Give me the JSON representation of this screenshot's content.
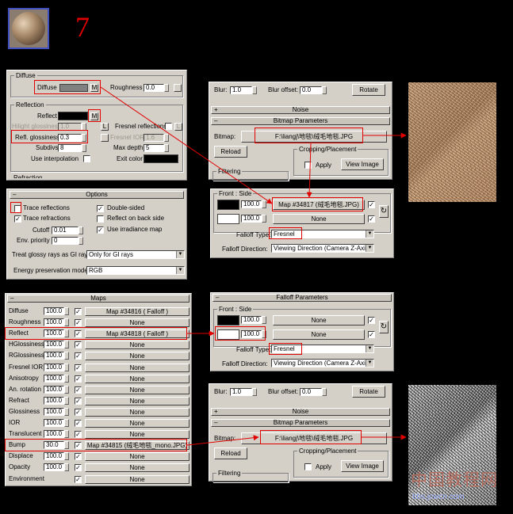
{
  "step_number": "7",
  "watermark": {
    "line1": "中国教程网",
    "line2": "bbs.jcwcn.com"
  },
  "vray_mtl": {
    "diffuse_group": "Diffuse",
    "diffuse_label": "Diffuse",
    "map_btn": "M",
    "roughness_label": "Roughness",
    "roughness_value": "0.0",
    "reflection_group": "Reflection",
    "reflect_label": "Reflect",
    "hilight_label": "Hilight glossiness",
    "hilight_value": "1.0",
    "lock_btn": "L",
    "fresnel_label": "Fresnel reflections",
    "refl_gloss_label": "Refl. glossiness",
    "refl_gloss_value": "0.3",
    "fresnel_ior_label": "Fresnel IOR",
    "fresnel_ior_value": "1.6",
    "subdivs_label": "Subdivs",
    "subdivs_value": "8",
    "max_depth_label": "Max depth",
    "max_depth_value": "5",
    "use_interp_label": "Use interpolation",
    "exit_color_label": "Exit color",
    "partial_label": "Refraction"
  },
  "options": {
    "title": "Options",
    "trace_reflections": "Trace reflections",
    "trace_refractions": "Trace refractions",
    "double_sided": "Double-sided",
    "reflect_back": "Reflect on back side",
    "use_irradiance": "Use irradiance map",
    "cutoff_label": "Cutoff",
    "cutoff_value": "0.01",
    "env_priority_label": "Env. priority",
    "env_priority_value": "0",
    "glossy_gi_label": "Treat glossy rays as GI rays:",
    "glossy_gi_value": "Only for GI rays",
    "energy_label": "Energy preservation mode:",
    "energy_value": "RGB"
  },
  "maps": {
    "title": "Maps",
    "rows": [
      {
        "name": "Diffuse",
        "amount": "100.0",
        "map": "Map #34816  ( Falloff )"
      },
      {
        "name": "Roughness",
        "amount": "100.0",
        "map": "None"
      },
      {
        "name": "Reflect",
        "amount": "100.0",
        "map": "Map #34818  ( Falloff )"
      },
      {
        "name": "HGlossiness",
        "amount": "100.0",
        "map": "None"
      },
      {
        "name": "RGlossiness",
        "amount": "100.0",
        "map": "None"
      },
      {
        "name": "Fresnel IOR",
        "amount": "100.0",
        "map": "None"
      },
      {
        "name": "Anisotropy",
        "amount": "100.0",
        "map": "None"
      },
      {
        "name": "An. rotation",
        "amount": "100.0",
        "map": "None"
      },
      {
        "name": "Refract",
        "amount": "100.0",
        "map": "None"
      },
      {
        "name": "Glossiness",
        "amount": "100.0",
        "map": "None"
      },
      {
        "name": "IOR",
        "amount": "100.0",
        "map": "None"
      },
      {
        "name": "Translucent",
        "amount": "100.0",
        "map": "None"
      },
      {
        "name": "Bump",
        "amount": "30.0",
        "map": "Map #34815 (绒毛地毯_mono.JPG)"
      },
      {
        "name": "Displace",
        "amount": "100.0",
        "map": "None"
      },
      {
        "name": "Opacity",
        "amount": "100.0",
        "map": "None"
      },
      {
        "name": "Environment",
        "amount": "",
        "map": "None"
      }
    ]
  },
  "bitmap1": {
    "blur_label": "Blur:",
    "blur_value": "1.0",
    "blur_offset_label": "Blur offset:",
    "blur_offset_value": "0.0",
    "rotate_btn": "Rotate",
    "noise_title": "Noise",
    "bitmap_params_title": "Bitmap Parameters",
    "bitmap_label": "Bitmap:",
    "bitmap_path": "F:\\liangj\\地毯\\绒毛地毯.JPG",
    "reload_btn": "Reload",
    "cropping_label": "Cropping/Placement",
    "apply_label": "Apply",
    "view_image_btn": "View Image",
    "filtering_label": "Filtering"
  },
  "falloff1": {
    "group_label": "Front : Side",
    "amount1": "100.0",
    "map1": "Map #34817 (绒毛地毯.JPG)",
    "amount2": "100.0",
    "map2": "None",
    "falloff_type_label": "Falloff Type:",
    "falloff_type_value": "Fresnel",
    "falloff_dir_label": "Falloff Direction:",
    "falloff_dir_value": "Viewing Direction (Camera Z-Axis)"
  },
  "falloff2": {
    "title": "Falloff Parameters",
    "group_label": "Front : Side",
    "amount1": "100.0",
    "map1": "None",
    "amount2": "100.0",
    "map2": "None",
    "falloff_type_label": "Falloff Type:",
    "falloff_type_value": "Fresnel",
    "falloff_dir_label": "Falloff Direction:",
    "falloff_dir_value": "Viewing Direction (Camera Z-Axis)"
  },
  "bitmap2": {
    "blur_label": "Blur:",
    "blur_value": "1.0",
    "blur_offset_label": "Blur offset:",
    "blur_offset_value": "0.0",
    "rotate_btn": "Rotate",
    "noise_title": "Noise",
    "bitmap_params_title": "Bitmap Parameters",
    "bitmap_label": "Bitmap:",
    "bitmap_path": "F:\\liangj\\地毯\\绒毛地毯.JPG",
    "reload_btn": "Reload",
    "cropping_label": "Cropping/Placement",
    "apply_label": "Apply",
    "view_image_btn": "View Image",
    "filtering_label": "Filtering"
  },
  "colors": {
    "annotation_red": "#e00000",
    "ui_gray": "#d4d0c8"
  }
}
